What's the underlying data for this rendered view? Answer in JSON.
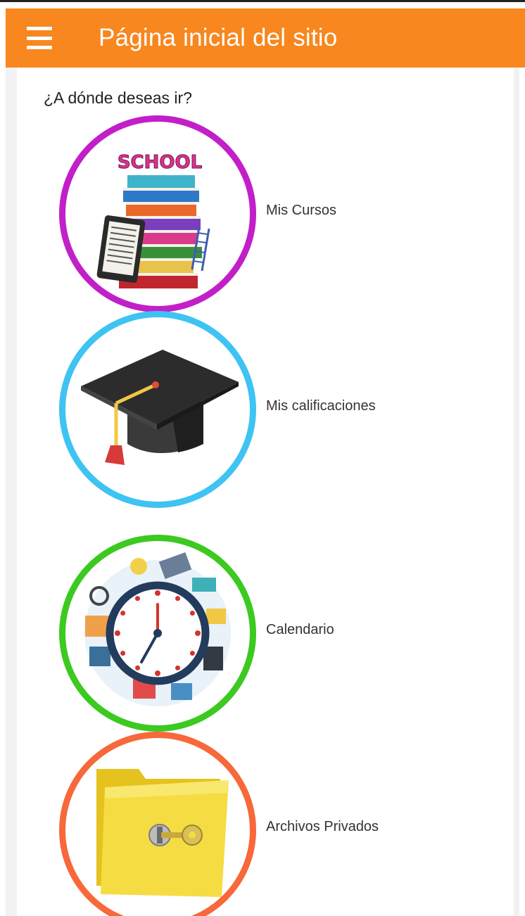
{
  "appbar": {
    "title": "Página inicial del sitio",
    "color": "#f7871e"
  },
  "main": {
    "prompt": "¿A dónde deseas ir?",
    "items": [
      {
        "label": "Mis Cursos",
        "ring_color": "#c21fc9",
        "icon": "books-icon"
      },
      {
        "label": "Mis calificaciones",
        "ring_color": "#3ec3f2",
        "icon": "graduation-cap-icon"
      },
      {
        "label": "Calendario",
        "ring_color": "#3cc920",
        "icon": "clock-icon"
      },
      {
        "label": "Archivos Privados",
        "ring_color": "#f7683a",
        "icon": "locked-folder-icon"
      }
    ],
    "school_sign": "SCHOOL"
  }
}
